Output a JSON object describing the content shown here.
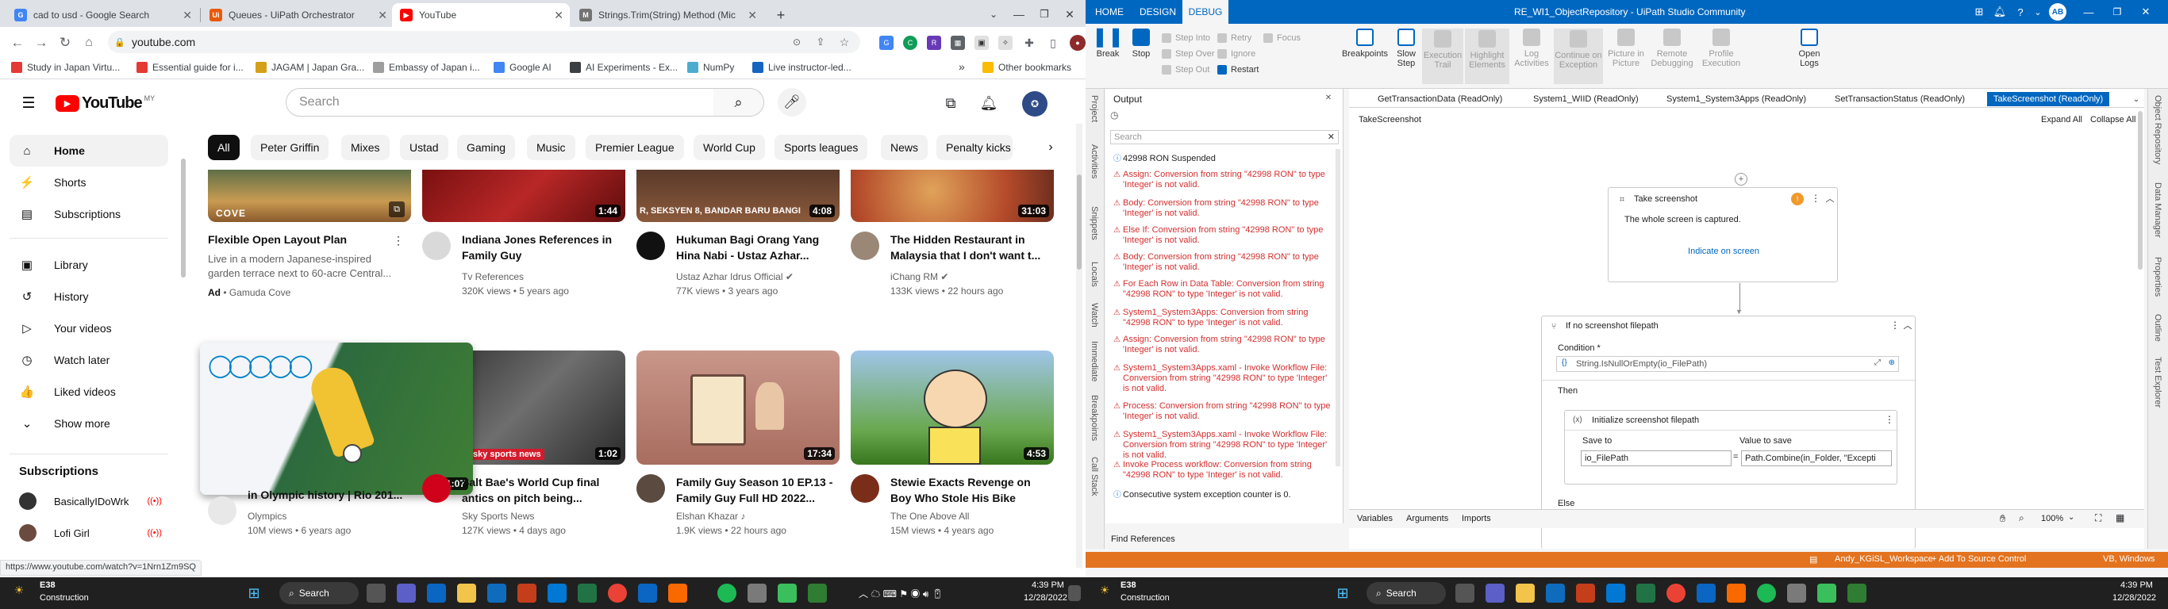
{
  "chrome": {
    "tabs": [
      {
        "title": "cad to usd - Google Search",
        "color": "#4285f4",
        "glyph": "G"
      },
      {
        "title": "Queues - UiPath Orchestrator",
        "color": "#e8590c",
        "glyph": "Ui"
      },
      {
        "title": "YouTube",
        "color": "#ff0000",
        "glyph": "▶"
      },
      {
        "title": "Strings.Trim(String) Method (Mic",
        "color": "#737373",
        "glyph": "M"
      }
    ],
    "url": "youtube.com",
    "bookmarks": [
      "Study in Japan Virtu...",
      "Essential guide for i...",
      "JAGAM | Japan Gra...",
      "Embassy of Japan i...",
      "Google AI",
      "AI Experiments - Ex...",
      "NumPy",
      "Live instructor-led..."
    ],
    "bookmarks_more": "»",
    "other_bookmarks": "Other bookmarks",
    "status_link": "https://www.youtube.com/watch?v=1Nrn1Zm9SQ"
  },
  "youtube": {
    "logo": "YouTube",
    "region": "MY",
    "search_placeholder": "Search",
    "sidebar": [
      {
        "label": "Home",
        "icon": "⌂"
      },
      {
        "label": "Shorts",
        "icon": "⚡"
      },
      {
        "label": "Subscriptions",
        "icon": "▤"
      },
      {
        "label": "Library",
        "icon": "▣"
      },
      {
        "label": "History",
        "icon": "↺"
      },
      {
        "label": "Your videos",
        "icon": "▷"
      },
      {
        "label": "Watch later",
        "icon": "◷"
      },
      {
        "label": "Liked videos",
        "icon": "👍"
      },
      {
        "label": "Show more",
        "icon": "⌄"
      }
    ],
    "subscriptions_heading": "Subscriptions",
    "subscriptions": [
      "BasicallyIDoWrk",
      "Lofi Girl"
    ],
    "chips": [
      "All",
      "Peter Griffin",
      "Mixes",
      "Ustad",
      "Gaming",
      "Music",
      "Premier League",
      "World Cup",
      "Sports leagues",
      "News",
      "Penalty kicks"
    ],
    "videos_row1": [
      {
        "title": "Flexible Open Layout Plan",
        "desc": "Live in a modern Japanese-inspired garden terrace next to 60-acre Central...",
        "ad": "Ad",
        "channel": "Gamuda Cove",
        "thumb": "#b8873e",
        "brand": "COVE"
      },
      {
        "title": "Indiana Jones References in Family Guy",
        "channel": "Tv References",
        "meta": "320K views • 5 years ago",
        "duration": "1:44",
        "thumb": "#9d1d1d"
      },
      {
        "title": "Hukuman Bagi Orang Yang Hina Nabi - Ustaz Azhar...",
        "channel": "Ustaz Azhar Idrus Official",
        "meta": "77K views • 3 years ago",
        "duration": "4:08",
        "thumb": "#6b3a2a",
        "overlay": "R, SEKSYEN 8, BANDAR BARU BANGI"
      },
      {
        "title": "The Hidden Restaurant in Malaysia that I don't want t...",
        "channel": "iChang RM",
        "meta": "133K views • 22 hours ago",
        "duration": "31:03",
        "thumb": "#c4603a"
      }
    ],
    "videos_row2": [
      {
        "title": "in Olympic history | Rio 201...",
        "channel": "Olympics",
        "meta": "10M views • 6 years ago",
        "duration": "1:07",
        "thumb": "#e9eef3"
      },
      {
        "title": "Salt Bae's World Cup final antics on pitch being...",
        "channel": "Sky Sports News",
        "meta": "127K views • 4 days ago",
        "duration": "1:02",
        "thumb": "#4a4a4a",
        "overlay": "sky sports news"
      },
      {
        "title": "Family Guy Season 10 EP.13 - Family Guy Full HD 2022...",
        "channel": "Elshan Khazar",
        "meta": "1.9K views • 22 hours ago",
        "duration": "17:34",
        "thumb": "#b07c6c"
      },
      {
        "title": "Stewie Exacts Revenge on Boy Who Stole His Bike",
        "channel": "The One Above All",
        "meta": "15M views • 4 years ago",
        "duration": "4:53",
        "thumb": "#6aa84f"
      }
    ]
  },
  "uipath": {
    "tabs": [
      "HOME",
      "DESIGN",
      "DEBUG"
    ],
    "window_title": "RE_WI1_ObjectRepository - UiPath Studio Community",
    "user_initials": "AB",
    "ribbon": {
      "break": "Break",
      "stop": "Stop",
      "step_into": "Step Into",
      "step_over": "Step Over",
      "step_out": "Step Out",
      "retry": "Retry",
      "ignore": "Ignore",
      "restart": "Restart",
      "focus": "Focus",
      "breakpoints": "Breakpoints",
      "slow_step": "Slow Step",
      "execution_trail": "Execution Trail",
      "highlight": "Highlight Elements",
      "log_activities": "Log Activities",
      "continue_exception": "Continue on Exception",
      "picture": "Picture in Picture",
      "remote": "Remote Debugging",
      "profile": "Profile Execution",
      "open_logs": "Open Logs"
    },
    "left_rail": [
      "Project",
      "Activities",
      "Snippets",
      "Locals",
      "Watch",
      "Immediate",
      "Breakpoints",
      "Call Stack"
    ],
    "output_title": "Output",
    "output_search": "Search",
    "output_lines": [
      {
        "type": "info",
        "text": "42998 RON Suspended"
      },
      {
        "type": "error",
        "text": "Assign: Conversion from string \"42998 RON\" to type 'Integer' is not valid."
      },
      {
        "type": "error",
        "text": "Body: Conversion from string \"42998 RON\" to type 'Integer' is not valid."
      },
      {
        "type": "error",
        "text": "Else If: Conversion from string \"42998 RON\" to type 'Integer' is not valid."
      },
      {
        "type": "error",
        "text": "Body: Conversion from string \"42998 RON\" to type 'Integer' is not valid."
      },
      {
        "type": "error",
        "text": "For Each Row in Data Table: Conversion from string \"42998 RON\" to type 'Integer' is not valid."
      },
      {
        "type": "error",
        "text": "System1_System3Apps: Conversion from string \"42998 RON\" to type 'Integer' is not valid."
      },
      {
        "type": "error",
        "text": "Assign: Conversion from string \"42998 RON\" to type 'Integer' is not valid."
      },
      {
        "type": "error",
        "text": "System1_System3Apps.xaml - Invoke Workflow File: Conversion from string \"42998 RON\" to type 'Integer' is not valid."
      },
      {
        "type": "error",
        "text": "Process: Conversion from string \"42998 RON\" to type 'Integer' is not valid."
      },
      {
        "type": "error",
        "text": "System1_System3Apps.xaml - Invoke Workflow File: Conversion from string \"42998 RON\" to type 'Integer' is not valid."
      },
      {
        "type": "error",
        "text": "Invoke Process workflow: Conversion from string \"42998 RON\" to type 'Integer' is not valid."
      },
      {
        "type": "info",
        "text": "Consecutive system exception counter is 0."
      }
    ],
    "find_references": "Find References",
    "doc_tabs": [
      "GetTransactionData (ReadOnly)",
      "System1_WIID (ReadOnly)",
      "System1_System3Apps (ReadOnly)",
      "SetTransactionStatus (ReadOnly)",
      "TakeScreenshot (ReadOnly)"
    ],
    "breadcrumb": "TakeScreenshot",
    "expand_all": "Expand All",
    "collapse_all": "Collapse All",
    "take_screenshot": {
      "title": "Take screenshot",
      "desc": "The whole screen is captured.",
      "link": "Indicate on screen"
    },
    "if_block": {
      "title": "If no screenshot filepath",
      "condition_label": "Condition *",
      "condition": "String.IsNullOrEmpty(io_FilePath)",
      "then": "Then",
      "else": "Else"
    },
    "assign": {
      "title": "Initialize screenshot filepath",
      "save_to": "Save to",
      "value_to_save": "Value to save",
      "to": "io_FilePath",
      "value": "Path.Combine(in_Folder, \"Excepti"
    },
    "bottom_tabs": [
      "Variables",
      "Arguments",
      "Imports"
    ],
    "zoom": "100%",
    "right_rail": [
      "Object Repository",
      "Data Manager",
      "Properties",
      "Outline",
      "Test Explorer"
    ],
    "status": {
      "workspace": "Andy_KGiSL_Workspace",
      "source": "Add To Source Control",
      "version": "VB, Windows"
    }
  },
  "taskbar": {
    "weather": [
      {
        "temp": "E38",
        "cond": "Construction"
      },
      {
        "temp": "E38",
        "cond": "Construction"
      }
    ],
    "search": "Search",
    "time": "4:39 PM",
    "date": "12/28/2022"
  }
}
